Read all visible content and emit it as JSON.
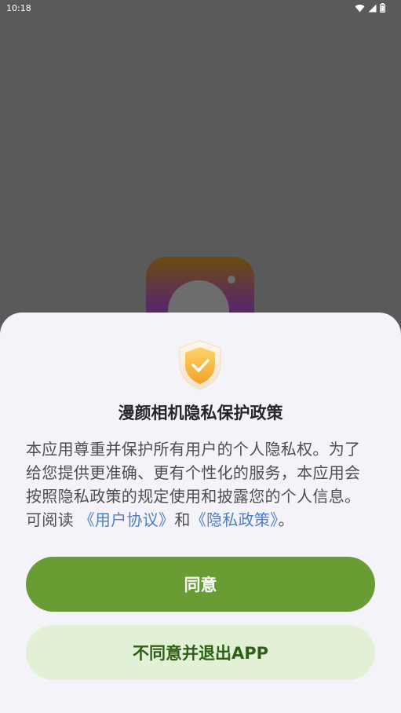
{
  "status_bar": {
    "time": "10:18",
    "icons": [
      "wifi-icon",
      "signal-icon",
      "battery-icon"
    ]
  },
  "background_app": {
    "logo_icon": "camera-app-logo"
  },
  "dialog": {
    "shield_icon": "shield-check-icon",
    "title": "漫颜相机隐私保护政策",
    "body_intro": "本应用尊重并保护所有用户的个人隐私权。为了给您提供更准确、更有个性化的服务，本应用会按照隐私政策的规定使用和披露您的个人信息。可阅读 ",
    "link_user_agreement": "《用户协议》",
    "body_and": "和",
    "link_privacy_policy": "《隐私政策》",
    "body_end": "。",
    "agree_label": "同意",
    "decline_label": "不同意并退出APP"
  },
  "colors": {
    "overlay": "#5a5a5a",
    "sheet_bg": "#f4f3f9",
    "link": "#4f7fc5",
    "primary": "#699c32",
    "secondary_bg": "#e2f0d6",
    "secondary_text": "#2f6018"
  }
}
